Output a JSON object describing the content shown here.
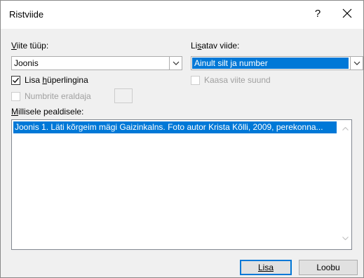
{
  "dialog": {
    "title": "Ristviide",
    "help": "?",
    "close_icon": "close-icon"
  },
  "reference_type": {
    "label": "Viite tüüp:",
    "value": "Joonis"
  },
  "insert_reference": {
    "label": "Lisatav viide:",
    "value": "Ainult silt ja number"
  },
  "hyperlink": {
    "label": "Lisa hüperlingina",
    "checked": true
  },
  "include_above_below": {
    "label": "Kaasa viite suund",
    "checked": false,
    "disabled": true
  },
  "separate_numbers": {
    "label": "Numbrite eraldaja",
    "checked": false,
    "disabled": true,
    "value": ""
  },
  "for_which_caption": {
    "label": "Millisele pealdisele:",
    "items": [
      "Joonis 1. Läti kõrgeim mägi Gaizinkalns. Foto autor Krista Kõlli, 2009, perekonna..."
    ]
  },
  "buttons": {
    "insert": "Lisa",
    "cancel": "Loobu"
  },
  "colors": {
    "accent": "#0078d7",
    "dialog_bg": "#f0f0f0"
  }
}
